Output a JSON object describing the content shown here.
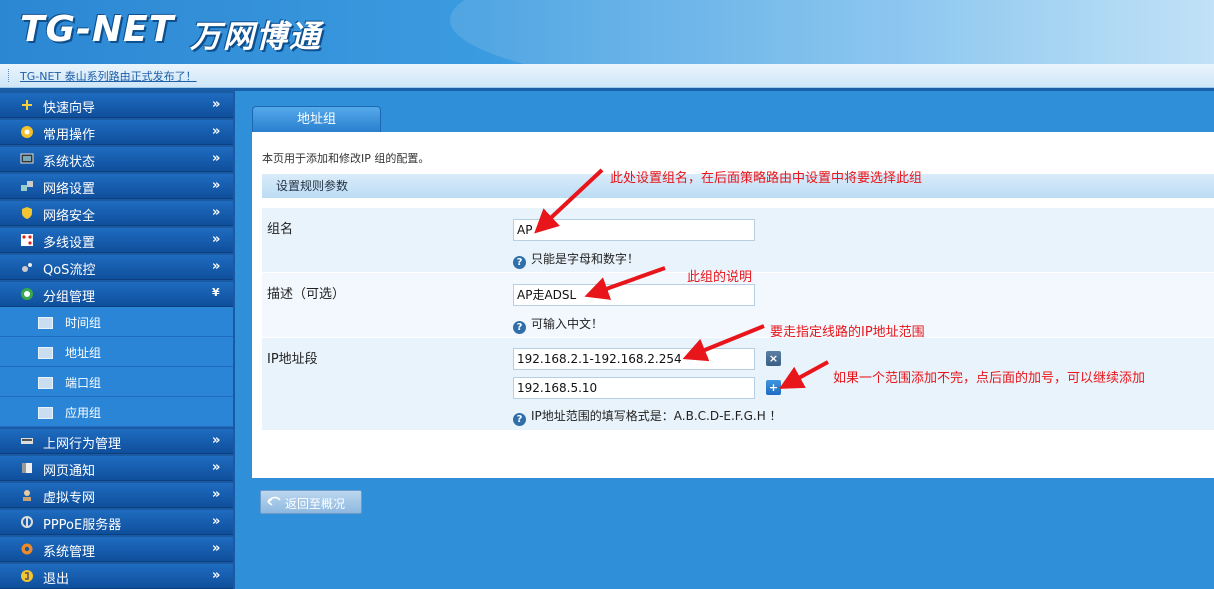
{
  "brand": {
    "latin": "TG-NET",
    "chinese": "万网博通"
  },
  "news": {
    "text": "TG-NET 泰山系列路由正式发布了！"
  },
  "sidebar": {
    "items": [
      {
        "label": "快速向导",
        "icon": "wand-icon",
        "arrow": "»"
      },
      {
        "label": "常用操作",
        "icon": "star-icon",
        "arrow": "»"
      },
      {
        "label": "系统状态",
        "icon": "monitor-icon",
        "arrow": "»"
      },
      {
        "label": "网络设置",
        "icon": "network-icon",
        "arrow": "»"
      },
      {
        "label": "网络安全",
        "icon": "shield-icon",
        "arrow": "»"
      },
      {
        "label": "多线设置",
        "icon": "multiline-icon",
        "arrow": "»"
      },
      {
        "label": "QoS流控",
        "icon": "qos-icon",
        "arrow": "»"
      },
      {
        "label": "分组管理",
        "icon": "group-icon",
        "arrow": "»",
        "expanded": true
      }
    ],
    "subitems": [
      {
        "label": "时间组"
      },
      {
        "label": "地址组"
      },
      {
        "label": "端口组"
      },
      {
        "label": "应用组"
      }
    ],
    "items_after": [
      {
        "label": "上网行为管理",
        "icon": "behavior-icon",
        "arrow": "»"
      },
      {
        "label": "网页通知",
        "icon": "notice-icon",
        "arrow": "»"
      },
      {
        "label": "虚拟专网",
        "icon": "vpn-icon",
        "arrow": "»"
      },
      {
        "label": "PPPoE服务器",
        "icon": "pppoe-icon",
        "arrow": "»"
      },
      {
        "label": "系统管理",
        "icon": "gear-icon",
        "arrow": "»"
      },
      {
        "label": "退出",
        "icon": "exit-icon",
        "arrow": "»"
      }
    ]
  },
  "tab": {
    "label": "地址组"
  },
  "content": {
    "description": "本页用于添加和修改IP 组的配置。",
    "section_title": "设置规则参数",
    "group_name": {
      "label": "组名",
      "value": "AP",
      "hint": "只能是字母和数字！"
    },
    "remark": {
      "label": "描述（可选）",
      "value": "AP走ADSL",
      "hint": "可输入中文！"
    },
    "ip_range": {
      "label": "IP地址段",
      "values": [
        "192.168.2.1-192.168.2.254",
        "192.168.5.10"
      ],
      "remove_label": "×",
      "add_label": "+",
      "hint": "IP地址范围的填写格式是：A.B.C.D-E.F.G.H ！"
    },
    "help_glyph": "?"
  },
  "back_button": {
    "label": "返回至概况"
  },
  "annotations": {
    "group_name_note": "此处设置组名，在后面策略路由中设置中将要选择此组",
    "remark_note": "此组的说明",
    "ip_note": "要走指定线路的IP地址范围",
    "add_note": "如果一个范围添加不完，点后面的加号，可以继续添加"
  },
  "colors": {
    "nav_bg": "#1a5aa3",
    "content_bg": "#2f8fd8",
    "annotation": "#e8151a"
  }
}
